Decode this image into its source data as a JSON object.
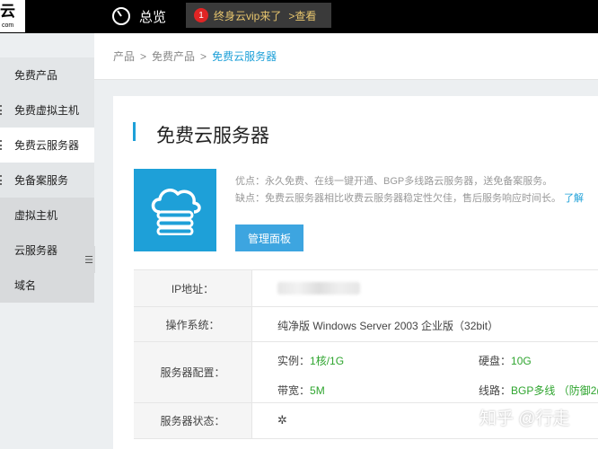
{
  "topbar": {
    "logo_glyph": "云",
    "logo_sub": "com",
    "overview_label": "总览",
    "vip_badge": "1",
    "vip_text": "终身云vip来了",
    "vip_link": ">查看"
  },
  "sidebar": {
    "items": [
      {
        "label": "免费产品"
      },
      {
        "label": "免费虚拟主机"
      },
      {
        "label": "免费云服务器"
      },
      {
        "label": "免备案服务"
      },
      {
        "label": "虚拟主机"
      },
      {
        "label": "云服务器"
      },
      {
        "label": "域名"
      }
    ],
    "collapse_glyph": "☰"
  },
  "breadcrumb": {
    "items": [
      "产品",
      "免费产品"
    ],
    "separator": ">",
    "current": "免费云服务器"
  },
  "product": {
    "title": "免费云服务器",
    "pros": "优点：永久免费、在线一键开通、BGP多线路云服务器，送免备案服务。",
    "cons": "缺点：免费云服务器相比收费云服务器稳定性欠佳，售后服务响应时间长。",
    "cons_link": "了解",
    "manage_button": "管理面板"
  },
  "info": {
    "ip_label": "IP地址：",
    "os_label": "操作系统：",
    "os_value": "纯净版 Windows Server 2003 企业版（32bit）",
    "config_label": "服务器配置：",
    "instance_label": "实例：",
    "instance_value": "1核/1G",
    "disk_label": "硬盘：",
    "disk_value": "10G",
    "bandwidth_label": "带宽：",
    "bandwidth_value": "5M",
    "line_label": "线路：",
    "line_value": "BGP多线 （防御2(",
    "status_label": "服务器状态：",
    "status_icon": "loading-spinner-icon"
  },
  "watermark": "知乎 @行走"
}
